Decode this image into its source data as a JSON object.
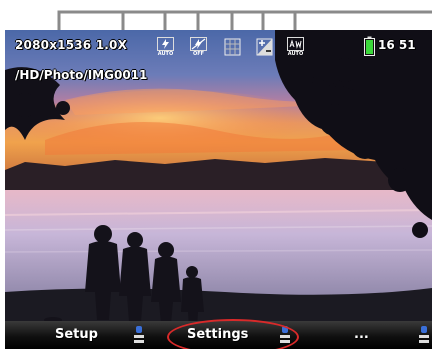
{
  "osd": {
    "resolution": "2080x1536 1.0X",
    "path": "/HD/Photo/IMG0011",
    "clock": "16 51",
    "icons": [
      {
        "name": "auto-flash-icon",
        "tag": "AUTO"
      },
      {
        "name": "flash-off-icon",
        "tag": "OFF"
      },
      {
        "name": "grid-icon",
        "tag": ""
      },
      {
        "name": "exposure-compensation-icon",
        "tag": ""
      },
      {
        "name": "white-balance-auto-icon",
        "tag": "AUTO"
      }
    ],
    "battery_icon": "battery-full-icon",
    "battery_color": "#3bd83b"
  },
  "menu": {
    "items": [
      {
        "label": "Setup"
      },
      {
        "label": "Settings"
      },
      {
        "label": "..."
      }
    ],
    "button_icon": "side-button-icon",
    "button_color": "#3a6fd8",
    "highlight_color": "#d92a2a"
  },
  "callout": {
    "color": "#888888"
  }
}
